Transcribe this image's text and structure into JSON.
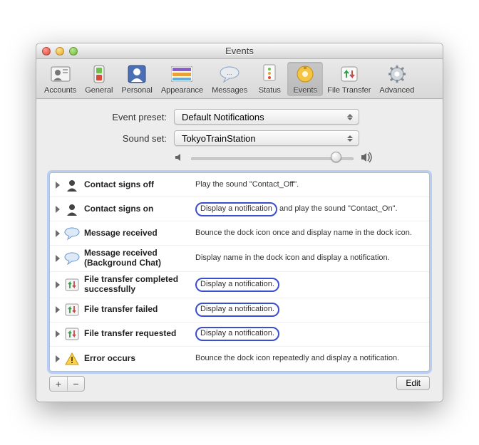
{
  "window": {
    "title": "Events"
  },
  "toolbar": {
    "items": [
      {
        "label": "Accounts"
      },
      {
        "label": "General"
      },
      {
        "label": "Personal"
      },
      {
        "label": "Appearance"
      },
      {
        "label": "Messages"
      },
      {
        "label": "Status"
      },
      {
        "label": "Events"
      },
      {
        "label": "File Transfer"
      },
      {
        "label": "Advanced"
      }
    ],
    "selected_index": 6
  },
  "form": {
    "preset_label": "Event preset:",
    "preset_value": "Default Notifications",
    "soundset_label": "Sound set:",
    "soundset_value": "TokyoTrainStation"
  },
  "volume": {
    "value": 86,
    "min": 0,
    "max": 100
  },
  "events": [
    {
      "icon": "person",
      "name": "Contact signs off",
      "desc_pre": "Play the sound \"Contact_Off\".",
      "desc_pill": "",
      "desc_post": ""
    },
    {
      "icon": "person",
      "name": "Contact signs on",
      "desc_pre": "",
      "desc_pill": "Display a notification",
      "desc_post": " and play the sound \"Contact_On\"."
    },
    {
      "icon": "bubble",
      "name": "Message received",
      "desc_pre": "Bounce the dock icon once and display name in the dock icon.",
      "desc_pill": "",
      "desc_post": ""
    },
    {
      "icon": "bubble",
      "name": "Message received (Background Chat)",
      "desc_pre": "Display name in the dock icon and display a notification.",
      "desc_pill": "",
      "desc_post": ""
    },
    {
      "icon": "transfer",
      "name": "File transfer completed successfully",
      "desc_pre": "",
      "desc_pill": "Display a notification.",
      "desc_post": ""
    },
    {
      "icon": "transfer",
      "name": "File transfer failed",
      "desc_pre": "",
      "desc_pill": "Display a notification.",
      "desc_post": ""
    },
    {
      "icon": "transfer",
      "name": "File transfer requested",
      "desc_pre": "",
      "desc_pill": "Display a notification.",
      "desc_post": ""
    },
    {
      "icon": "warning",
      "name": "Error occurs",
      "desc_pre": "Bounce the dock icon repeatedly and display a notification.",
      "desc_pill": "",
      "desc_post": ""
    }
  ],
  "buttons": {
    "add": "+",
    "remove": "−",
    "edit": "Edit"
  }
}
